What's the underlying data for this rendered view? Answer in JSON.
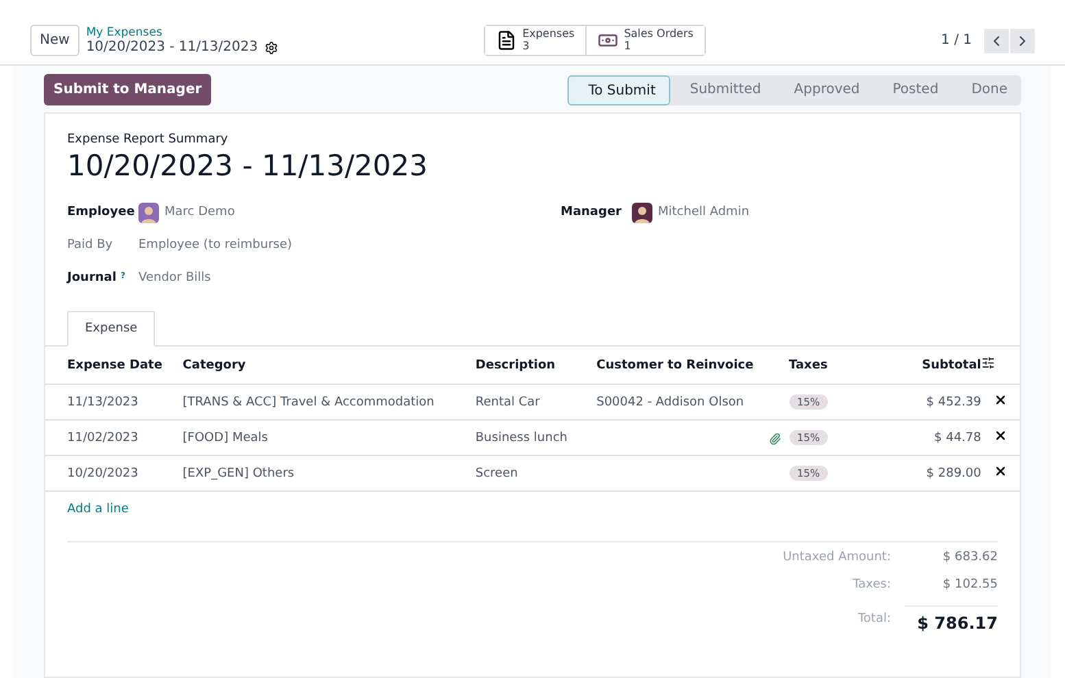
{
  "control_panel": {
    "new_button": "New",
    "breadcrumb": "My Expenses",
    "record_title": "10/20/2023 - 11/13/2023",
    "smart_buttons": [
      {
        "kind": "document",
        "label": "Expenses",
        "count": "3"
      },
      {
        "kind": "money",
        "label": "Sales Orders",
        "count": "1"
      }
    ],
    "pager": "1 / 1"
  },
  "action_button": "Submit to Manager",
  "status_steps": [
    {
      "label": "To Submit",
      "selected": true
    },
    {
      "label": "Submitted",
      "selected": false
    },
    {
      "label": "Approved",
      "selected": false
    },
    {
      "label": "Posted",
      "selected": false
    },
    {
      "label": "Done",
      "selected": false
    }
  ],
  "form": {
    "subtitle": "Expense Report Summary",
    "title": "10/20/2023 - 11/13/2023",
    "fields": [
      {
        "label": "Employee",
        "value": "Marc Demo",
        "avatar": true,
        "strong": true
      },
      {
        "label": "Paid By",
        "value": "Employee (to reimburse)",
        "avatar": false,
        "strong": false
      },
      {
        "label": "Journal",
        "value": "Vendor Bills",
        "help": "?",
        "avatar": false,
        "strong": true
      }
    ],
    "manager": {
      "label": "Manager",
      "value": "Mitchell Admin",
      "avatar": true
    }
  },
  "tabs": [
    {
      "label": "Expense",
      "selected": true
    }
  ],
  "table": {
    "columns": [
      "Expense Date",
      "Category",
      "Description",
      "Customer to Reinvoice",
      "Taxes",
      "Subtotal"
    ],
    "rows": [
      {
        "date": "11/13/2023",
        "category": "[TRANS & ACC] Travel & Accommodation",
        "description": "Rental Car",
        "customer": "S00042 - Addison Olson",
        "attachment": false,
        "tax": "15%",
        "subtotal": "$ 452.39"
      },
      {
        "date": "11/02/2023",
        "category": "[FOOD] Meals",
        "description": "Business lunch",
        "attachment": true,
        "tax": "15%",
        "subtotal": "$ 44.78"
      },
      {
        "date": "10/20/2023",
        "category": "[EXP_GEN] Others",
        "description": "Screen",
        "attachment": false,
        "tax": "15%",
        "subtotal": "$ 289.00"
      }
    ],
    "add_line": "Add a line"
  },
  "totals": [
    {
      "label": "Untaxed Amount:",
      "value": "$ 683.62",
      "grand": false
    },
    {
      "label": "Taxes:",
      "value": "$ 102.55",
      "grand": false
    },
    {
      "label": "Total:",
      "value": "$ 786.17",
      "grand": true
    }
  ]
}
